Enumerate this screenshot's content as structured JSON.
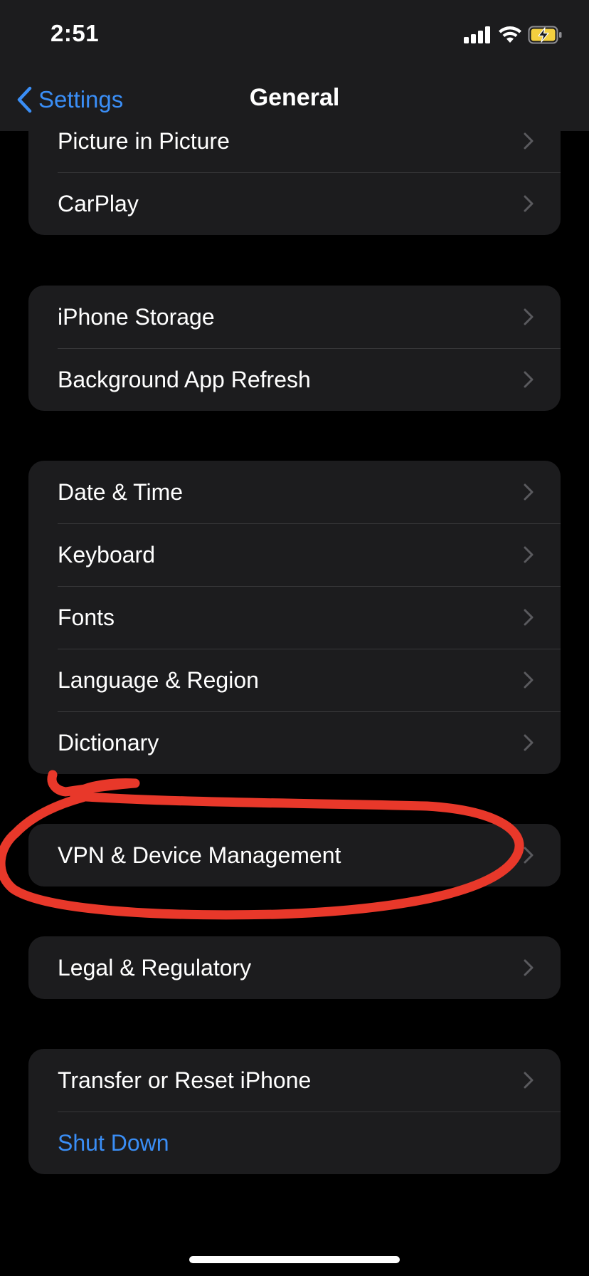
{
  "status_bar": {
    "time": "2:51"
  },
  "nav": {
    "back_label": "Settings",
    "title": "General"
  },
  "groups": [
    {
      "items": [
        {
          "label": "Picture in Picture"
        },
        {
          "label": "CarPlay"
        }
      ]
    },
    {
      "items": [
        {
          "label": "iPhone Storage"
        },
        {
          "label": "Background App Refresh"
        }
      ]
    },
    {
      "items": [
        {
          "label": "Date & Time"
        },
        {
          "label": "Keyboard"
        },
        {
          "label": "Fonts"
        },
        {
          "label": "Language & Region"
        },
        {
          "label": "Dictionary"
        }
      ]
    },
    {
      "items": [
        {
          "label": "VPN & Device Management"
        }
      ]
    },
    {
      "items": [
        {
          "label": "Legal & Regulatory"
        }
      ]
    },
    {
      "items": [
        {
          "label": "Transfer or Reset iPhone"
        },
        {
          "label": "Shut Down"
        }
      ]
    }
  ],
  "colors": {
    "background": "#000000",
    "group_background": "#1c1c1e",
    "accent": "#3a8ef6",
    "annotation": "#e8382a",
    "battery_charging": "#f4d03f"
  }
}
